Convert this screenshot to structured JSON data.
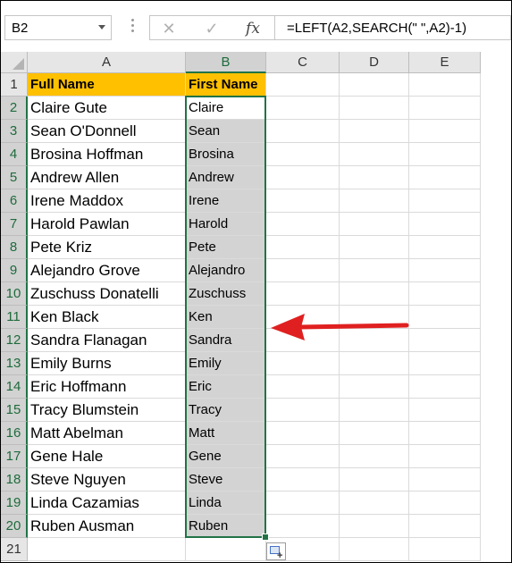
{
  "name_box": {
    "value": "B2"
  },
  "formula_bar": {
    "cancel_icon": "✕",
    "enter_icon": "✓",
    "fx_label": "fx",
    "formula": "=LEFT(A2,SEARCH(\" \",A2)-1)"
  },
  "columns": [
    "A",
    "B",
    "C",
    "D",
    "E"
  ],
  "rows": [
    {
      "num": "1",
      "a": "Full Name",
      "b": "First Name"
    },
    {
      "num": "2",
      "a": "Claire Gute",
      "b": "Claire"
    },
    {
      "num": "3",
      "a": "Sean O'Donnell",
      "b": "Sean"
    },
    {
      "num": "4",
      "a": "Brosina Hoffman",
      "b": "Brosina"
    },
    {
      "num": "5",
      "a": "Andrew Allen",
      "b": "Andrew"
    },
    {
      "num": "6",
      "a": "Irene Maddox",
      "b": "Irene"
    },
    {
      "num": "7",
      "a": "Harold Pawlan",
      "b": "Harold"
    },
    {
      "num": "8",
      "a": "Pete Kriz",
      "b": "Pete"
    },
    {
      "num": "9",
      "a": "Alejandro Grove",
      "b": "Alejandro"
    },
    {
      "num": "10",
      "a": "Zuschuss Donatelli",
      "b": "Zuschuss"
    },
    {
      "num": "11",
      "a": "Ken Black",
      "b": "Ken"
    },
    {
      "num": "12",
      "a": "Sandra Flanagan",
      "b": "Sandra"
    },
    {
      "num": "13",
      "a": "Emily Burns",
      "b": "Emily"
    },
    {
      "num": "14",
      "a": "Eric Hoffmann",
      "b": "Eric"
    },
    {
      "num": "15",
      "a": "Tracy Blumstein",
      "b": "Tracy"
    },
    {
      "num": "16",
      "a": "Matt Abelman",
      "b": "Matt"
    },
    {
      "num": "17",
      "a": "Gene Hale",
      "b": "Gene"
    },
    {
      "num": "18",
      "a": "Steve Nguyen",
      "b": "Steve"
    },
    {
      "num": "19",
      "a": "Linda Cazamias",
      "b": "Linda"
    },
    {
      "num": "20",
      "a": "Ruben Ausman",
      "b": "Ruben"
    },
    {
      "num": "21",
      "a": "",
      "b": ""
    }
  ],
  "selection": {
    "range": "B2:B20",
    "active_cell": "B2"
  },
  "colors": {
    "header_fill": "#ffc000",
    "selection_fill": "#d3d3d3",
    "selection_border": "#217346",
    "annotation_arrow": "#e02020"
  },
  "icons": {
    "quick_analysis": "quick-analysis-icon",
    "annotation": "red-arrow-icon"
  }
}
